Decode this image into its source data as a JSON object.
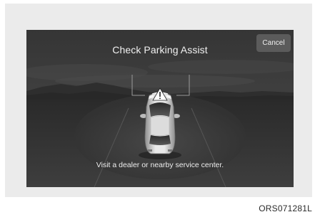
{
  "screen": {
    "title": "Check Parking Assist",
    "cancel_label": "Cancel",
    "message": "Visit a dealer or nearby service center."
  },
  "figure": {
    "code": "ORS071281L"
  },
  "icons": {
    "vehicle": "car-top-view-icon",
    "warning": "warning-triangle-icon"
  },
  "colors": {
    "screen_bg": "#3a3a3a",
    "button_bg": "#5b5b5b",
    "text": "#f1f1f1",
    "frame_bg": "#ebebeb"
  }
}
